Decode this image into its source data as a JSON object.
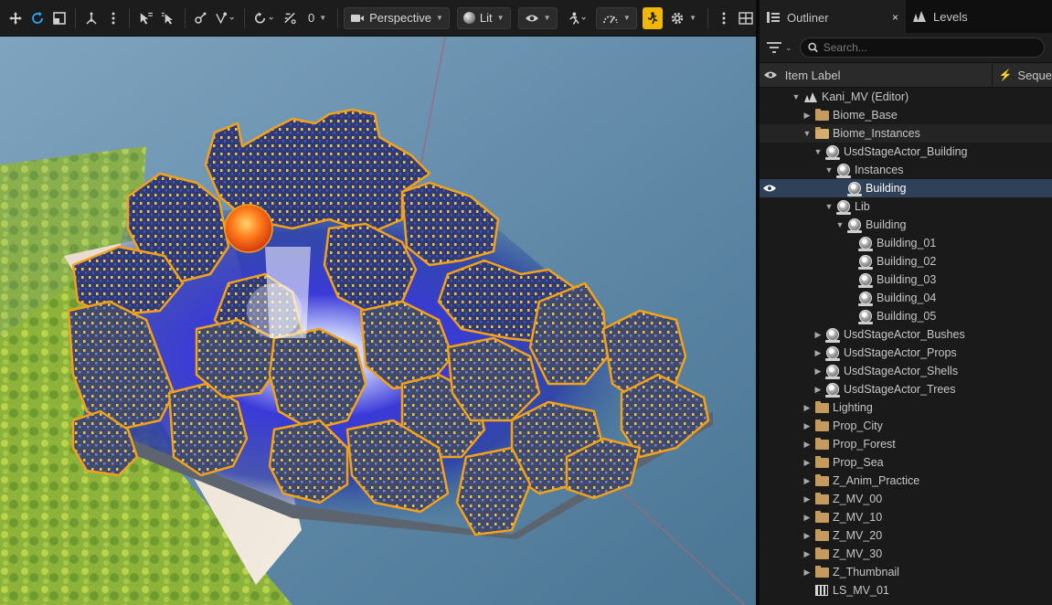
{
  "toolbar": {
    "tools": [
      {
        "name": "translate-icon"
      },
      {
        "name": "rotate-icon"
      },
      {
        "name": "scale-icon"
      },
      {
        "name": "coordinate-space-icon"
      },
      {
        "name": "more-options-icon"
      }
    ],
    "snap_value": "0",
    "view_mode": "Perspective",
    "lighting_mode": "Lit",
    "accent_color": "#f2b705",
    "active_tool_color": "#2aa4f4"
  },
  "outliner": {
    "tabs": [
      {
        "label": "Outliner",
        "active": true,
        "close": "×"
      },
      {
        "label": "Levels",
        "active": false
      }
    ],
    "search": {
      "placeholder": "Search..."
    },
    "columns": {
      "item_label": "Item Label",
      "sequence": "Seque"
    },
    "tree": [
      {
        "label": "Kani_MV (Editor)",
        "depth": 0,
        "icon": "level",
        "expanded": true,
        "arrow": "▼"
      },
      {
        "label": "Biome_Base",
        "depth": 1,
        "icon": "folder",
        "arrow": "▶"
      },
      {
        "label": "Biome_Instances",
        "depth": 1,
        "icon": "folder-open",
        "arrow": "▼",
        "highlight": true
      },
      {
        "label": "UsdStageActor_Building",
        "depth": 2,
        "icon": "actor",
        "arrow": "▼"
      },
      {
        "label": "Instances",
        "depth": 3,
        "icon": "actor",
        "arrow": "▼"
      },
      {
        "label": "Building",
        "depth": 4,
        "icon": "actor",
        "arrow": "",
        "selected": true,
        "eye": true
      },
      {
        "label": "Lib",
        "depth": 3,
        "icon": "actor",
        "arrow": "▼"
      },
      {
        "label": "Building",
        "depth": 4,
        "icon": "actor",
        "arrow": "▼"
      },
      {
        "label": "Building_01",
        "depth": 5,
        "icon": "actor",
        "arrow": ""
      },
      {
        "label": "Building_02",
        "depth": 5,
        "icon": "actor",
        "arrow": ""
      },
      {
        "label": "Building_03",
        "depth": 5,
        "icon": "actor",
        "arrow": ""
      },
      {
        "label": "Building_04",
        "depth": 5,
        "icon": "actor",
        "arrow": ""
      },
      {
        "label": "Building_05",
        "depth": 5,
        "icon": "actor",
        "arrow": ""
      },
      {
        "label": "UsdStageActor_Bushes",
        "depth": 2,
        "icon": "actor",
        "arrow": "▶"
      },
      {
        "label": "UsdStageActor_Props",
        "depth": 2,
        "icon": "actor",
        "arrow": "▶"
      },
      {
        "label": "UsdStageActor_Shells",
        "depth": 2,
        "icon": "actor",
        "arrow": "▶"
      },
      {
        "label": "UsdStageActor_Trees",
        "depth": 2,
        "icon": "actor",
        "arrow": "▶"
      },
      {
        "label": "Lighting",
        "depth": 1,
        "icon": "folder",
        "arrow": "▶"
      },
      {
        "label": "Prop_City",
        "depth": 1,
        "icon": "folder",
        "arrow": "▶"
      },
      {
        "label": "Prop_Forest",
        "depth": 1,
        "icon": "folder",
        "arrow": "▶"
      },
      {
        "label": "Prop_Sea",
        "depth": 1,
        "icon": "folder",
        "arrow": "▶"
      },
      {
        "label": "Z_Anim_Practice",
        "depth": 1,
        "icon": "folder",
        "arrow": "▶"
      },
      {
        "label": "Z_MV_00",
        "depth": 1,
        "icon": "folder",
        "arrow": "▶"
      },
      {
        "label": "Z_MV_10",
        "depth": 1,
        "icon": "folder",
        "arrow": "▶"
      },
      {
        "label": "Z_MV_20",
        "depth": 1,
        "icon": "folder",
        "arrow": "▶"
      },
      {
        "label": "Z_MV_30",
        "depth": 1,
        "icon": "folder",
        "arrow": "▶"
      },
      {
        "label": "Z_Thumbnail",
        "depth": 1,
        "icon": "folder",
        "arrow": "▶"
      },
      {
        "label": "LS_MV_01",
        "depth": 1,
        "icon": "sequence",
        "arrow": ""
      }
    ],
    "selection_color": "#2e4159"
  }
}
